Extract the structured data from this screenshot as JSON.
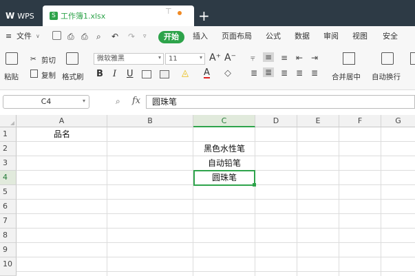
{
  "tabs": {
    "app_label": "WPS",
    "doc_name": "工作簿1.xlsx",
    "new_tab": "+"
  },
  "menu": {
    "file": "文件",
    "start": "开始",
    "items": [
      "插入",
      "页面布局",
      "公式",
      "数据",
      "审阅",
      "视图",
      "安全"
    ]
  },
  "ribbon": {
    "paste": "粘贴",
    "cut": "剪切",
    "copy": "复制",
    "format_painter": "格式刷",
    "font_name": "微软雅黑",
    "font_size": "11",
    "merge_center": "合并居中",
    "wrap_text": "自动换行",
    "bold": "B",
    "italic": "I",
    "underline": "U",
    "grow_font": "A⁺",
    "shrink_font": "A⁻"
  },
  "formula_bar": {
    "cell_ref": "C4",
    "fx": "fx",
    "content": "圆珠笔"
  },
  "sheet": {
    "columns": [
      "A",
      "B",
      "C",
      "D",
      "E",
      "F",
      "G"
    ],
    "rows": [
      "1",
      "2",
      "3",
      "4",
      "5",
      "6",
      "7",
      "8",
      "9",
      "10"
    ],
    "selected_column": "C",
    "selected_row": "4",
    "cells": {
      "A1": "品名",
      "C2": "黑色水性笔",
      "C3": "自动铅笔",
      "C4": "圆珠笔"
    }
  },
  "colors": {
    "accent": "#2da34a",
    "tabbar": "#2d3a45"
  }
}
